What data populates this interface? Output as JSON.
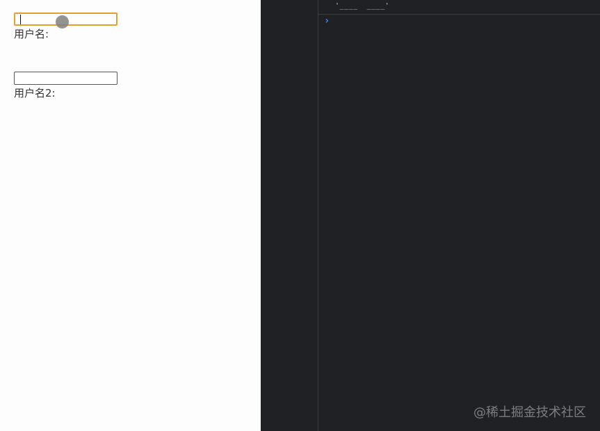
{
  "form": {
    "username_input": {
      "value": "",
      "placeholder": "",
      "focused": true
    },
    "username_label": "用户名:",
    "username2_input": {
      "value": "",
      "placeholder": "",
      "focused": false
    },
    "username2_label": "用户名2:"
  },
  "console": {
    "previous_output": "'____  ____'",
    "prompt_symbol": "›"
  },
  "watermark": "@稀土掘金技术社区",
  "colors": {
    "focus_border": "#e2a12a",
    "console_bg": "#202124",
    "prompt": "#3b8cff"
  }
}
